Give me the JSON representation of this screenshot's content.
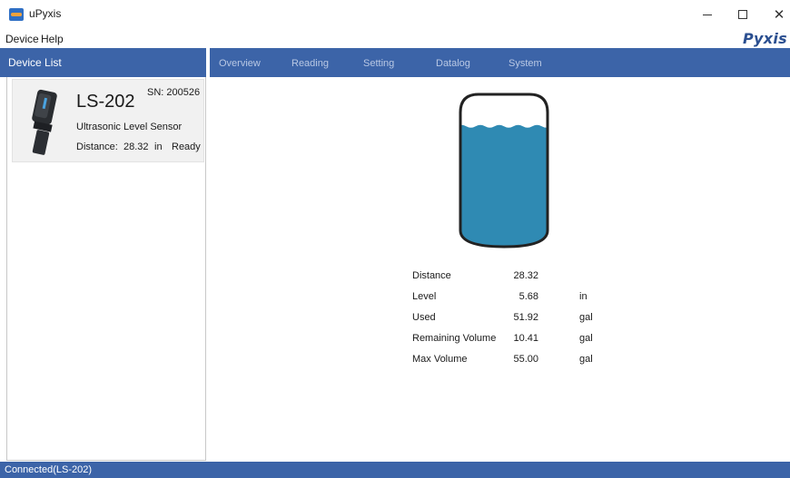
{
  "window": {
    "title": "uPyxis",
    "minimize_icon": "minimize-icon",
    "maximize_icon": "maximize-icon",
    "close_glyph": "✕"
  },
  "menu": {
    "items": [
      "Device",
      "Help"
    ],
    "brand": "Pyxis"
  },
  "device_list": {
    "header": "Device List",
    "devices": [
      {
        "model": "LS-202",
        "sn": "SN: 200526",
        "type": "Ultrasonic Level Sensor",
        "distance_label": "Distance:",
        "distance_value": "28.32",
        "distance_unit": "in",
        "status": "Ready"
      }
    ]
  },
  "tabs": [
    {
      "label": "Overview",
      "active": true
    },
    {
      "label": "Reading",
      "active": false
    },
    {
      "label": "Setting",
      "active": false
    },
    {
      "label": "Datalog",
      "active": false
    },
    {
      "label": "System",
      "active": false
    }
  ],
  "tank": {
    "fill_fraction": 0.79,
    "liquid_color": "#2f8ab3",
    "outline_color": "#222222"
  },
  "readings": [
    {
      "label": "Distance",
      "value": "28.32",
      "unit": ""
    },
    {
      "label": "Level",
      "value": "5.68",
      "unit": "in"
    },
    {
      "label": "Used",
      "value": "51.92",
      "unit": "gal"
    },
    {
      "label": "Remaining Volume",
      "value": "10.41",
      "unit": "gal"
    },
    {
      "label": "Max Volume",
      "value": "55.00",
      "unit": "gal"
    }
  ],
  "status_bar": {
    "text": "Connected(LS-202)"
  },
  "colors": {
    "accent": "#3c64a8",
    "brand": "#2b4f90"
  }
}
